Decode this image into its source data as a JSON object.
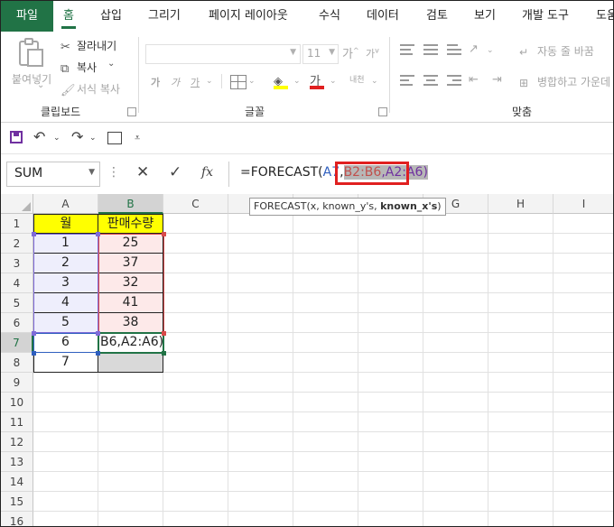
{
  "ribbon_tabs": [
    "파일",
    "홈",
    "삽입",
    "그리기",
    "페이지 레이아웃",
    "수식",
    "데이터",
    "검토",
    "보기",
    "개발 도구",
    "도움"
  ],
  "clipboard": {
    "paste_label_1": "붙여넣기",
    "paste_label_2": "",
    "cut": "잘라내기",
    "copy": "복사",
    "format_painter": "서식 복사",
    "group_label": "클립보드"
  },
  "font": {
    "font_size": "11",
    "grow": "가",
    "shrink": "가",
    "bold_sample": "가",
    "italic_sample": "가",
    "underline_sample": "가",
    "font_color_sample": "가",
    "phonetic": "내천",
    "group_label": "글꼴"
  },
  "alignment": {
    "wrap_text": "자동 줄 바꿈",
    "merge_center": "병합하고 가운데",
    "group_label": "맞춤"
  },
  "formula_bar": {
    "name_box": "SUM",
    "fx": "fx",
    "prefix": "=FORECAST(",
    "arg1": "A7",
    "comma1": ",",
    "arg2": "B2:B6",
    "comma2": ",",
    "arg3": "A2:A6",
    "suffix": ")"
  },
  "tooltip": {
    "prefix": "FORECAST(x, known_y's, ",
    "bold": "known_x's",
    "suffix": ")"
  },
  "grid": {
    "columns": [
      "A",
      "B",
      "C",
      "D",
      "E",
      "F",
      "G",
      "H",
      "I"
    ],
    "rows": [
      "1",
      "2",
      "3",
      "4",
      "5",
      "6",
      "7",
      "8",
      "9",
      "10",
      "11",
      "12",
      "13",
      "14",
      "15",
      "16"
    ],
    "header_month": "월",
    "header_sales": "판매수량",
    "months": [
      "1",
      "2",
      "3",
      "4",
      "5",
      "6",
      "7"
    ],
    "sales": [
      "25",
      "37",
      "32",
      "41",
      "38"
    ],
    "b7_edit": "B6,A2:A6)"
  }
}
